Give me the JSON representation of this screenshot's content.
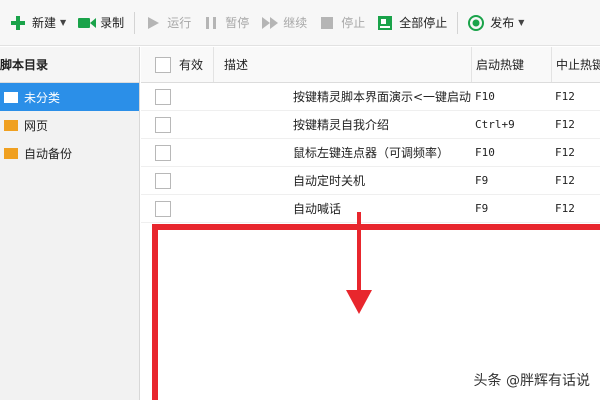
{
  "toolbar": {
    "new_label": "新建",
    "record_label": "录制",
    "run_label": "运行",
    "pause_label": "暂停",
    "resume_label": "继续",
    "stop_label": "停止",
    "stop_all_label": "全部停止",
    "publish_label": "发布"
  },
  "sidebar": {
    "title": "脚本目录",
    "items": [
      {
        "label": "未分类",
        "selected": true
      },
      {
        "label": "网页",
        "selected": false
      },
      {
        "label": "自动备份",
        "selected": false
      }
    ]
  },
  "table": {
    "headers": {
      "enabled": "有效",
      "description": "描述",
      "start_hotkey": "启动热键",
      "stop_hotkey": "中止热键"
    },
    "rows": [
      {
        "description": "按键精灵脚本界面演示<一键启动>",
        "start_hotkey": "F10",
        "stop_hotkey": "F12"
      },
      {
        "description": "按键精灵自我介绍",
        "start_hotkey": "Ctrl+9",
        "stop_hotkey": "F12"
      },
      {
        "description": "鼠标左键连点器（可调频率）",
        "start_hotkey": "F10",
        "stop_hotkey": "F12"
      },
      {
        "description": "自动定时关机",
        "start_hotkey": "F9",
        "stop_hotkey": "F12"
      },
      {
        "description": "自动喊话",
        "start_hotkey": "F9",
        "stop_hotkey": "F12"
      }
    ]
  },
  "watermark": "头条 @胖辉有话说",
  "colors": {
    "accent": "#2b8fe8",
    "annotation": "#e8262d",
    "green": "#1aa34a",
    "folder": "#f0a020"
  }
}
